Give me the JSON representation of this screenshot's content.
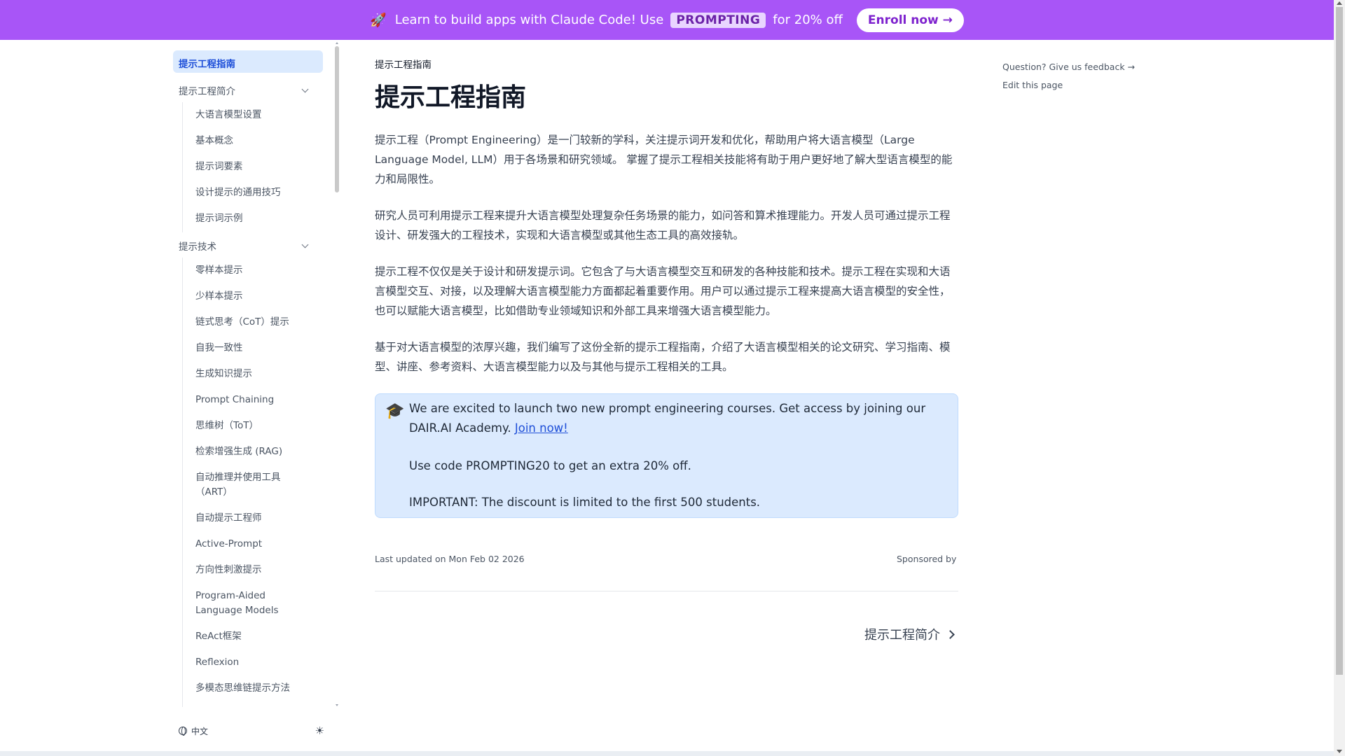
{
  "banner": {
    "icon": "rocket-icon",
    "text_before": "Learn to build apps with Claude Code! Use",
    "code": "PROMPTING",
    "text_after": "for 20% off",
    "enroll_label": "Enroll now →",
    "bg_color": "#a855f7"
  },
  "sidebar": {
    "active": "提示工程指南",
    "group1": "提示工程简介",
    "group1_items": [
      "大语言模型设置",
      "基本概念",
      "提示词要素",
      "设计提示的通用技巧",
      "提示词示例"
    ],
    "group2": "提示技术",
    "group2_items": [
      "零样本提示",
      "少样本提示",
      "链式思考（CoT）提示",
      "自我一致性",
      "生成知识提示",
      "Prompt Chaining",
      "思维树（ToT）",
      "检索增强生成 (RAG)",
      "自动推理并使用工具（ART）",
      "自动提示工程师",
      "Active-Prompt",
      "方向性刺激提示",
      "Program-Aided Language Models",
      "ReAct框架",
      "Reflexion",
      "多模态思维链提示方法"
    ],
    "footer_lang": "中文",
    "theme_icon": "sun-icon"
  },
  "main": {
    "breadcrumb": "提示工程指南",
    "title": "提示工程指南",
    "paragraphs": [
      "提示工程（Prompt Engineering）是一门较新的学科，关注提示词开发和优化，帮助用户将大语言模型（Large Language Model, LLM）用于各场景和研究领域。 掌握了提示工程相关技能将有助于用户更好地了解大型语言模型的能力和局限性。",
      "研究人员可利用提示工程来提升大语言模型处理复杂任务场景的能力，如问答和算术推理能力。开发人员可通过提示工程设计、研发强大的工程技术，实现和大语言模型或其他生态工具的高效接轨。",
      "提示工程不仅仅是关于设计和研发提示词。它包含了与大语言模型交互和研发的各种技能和技术。提示工程在实现和大语言模型交互、对接，以及理解大语言模型能力方面都起着重要作用。用户可以通过提示工程来提高大语言模型的安全性，也可以赋能大语言模型，比如借助专业领域知识和外部工具来增强大语言模型能力。",
      "基于对大语言模型的浓厚兴趣，我们编写了这份全新的提示工程指南，介绍了大语言模型相关的论文研究、学习指南、模型、讲座、参考资料、大语言模型能力以及与其他与提示工程相关的工具。"
    ],
    "callout": {
      "icon": "graduation-cap-icon",
      "line1": "We are excited to launch two new prompt engineering courses. Get access by joining our DAIR.AI Academy.",
      "link": "Join now!",
      "line2": "Use code PROMPTING20 to get an extra 20% off.",
      "line3": "IMPORTANT: The discount is limited to the first 500 students."
    },
    "last_updated": "Last updated on Mon Feb 02 2026",
    "sponsored": "Sponsored by",
    "next_label": "提示工程简介"
  },
  "toc": {
    "feedback": "Question? Give us feedback →",
    "edit": "Edit this page"
  }
}
